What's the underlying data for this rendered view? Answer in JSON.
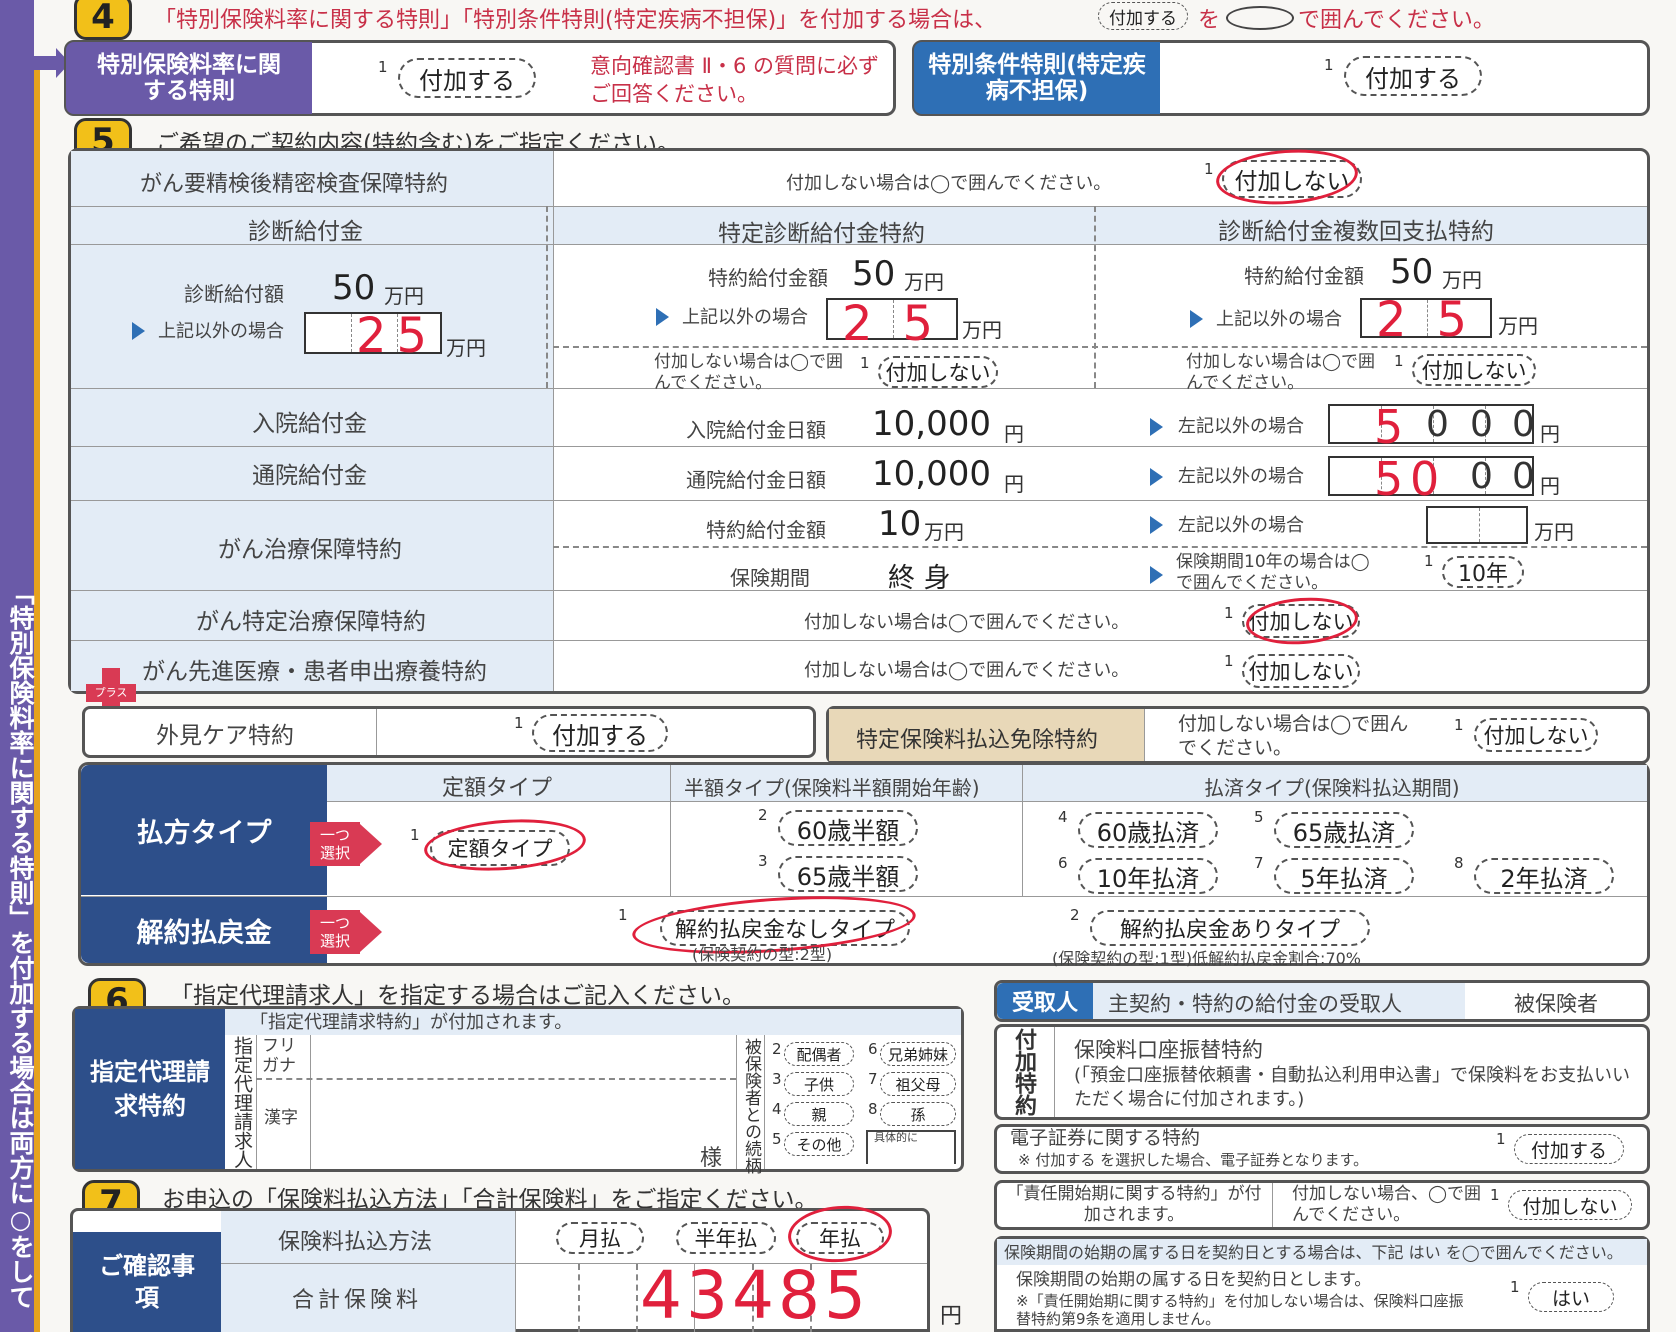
{
  "sidebar": {
    "text": "「特別保険料率に関する特則」を付加する場合は両方に○をして"
  },
  "s4": {
    "num": "4",
    "header_a": "「特別保険料率に関する特則」「特別条件特則(特定疾病不担保)」を付加する場合は、",
    "header_pill": "付加する",
    "header_b": "を",
    "header_c": "で囲んでください。",
    "left_title": "特別保険料率に関する特則",
    "left_no": "1",
    "left_opt": "付加する",
    "left_note": "意向確認書 Ⅱ・6 の質問に必ずご回答ください。",
    "right_title": "特別条件特則(特定疾病不担保)",
    "right_no": "1",
    "right_opt": "付加する"
  },
  "s5": {
    "num": "5",
    "title": "ご希望のご契約内容(特約含む)をご指定ください。",
    "gan_kensa": {
      "label": "がん要精検後精密検査保障特約",
      "note": "付加しない場合は◯で囲んでください。",
      "no": "1",
      "opt": "付加しない"
    },
    "shindan": {
      "label": "診断給付金",
      "amount_label": "診断給付額",
      "amount": "50",
      "amount_unit": "万円",
      "other_label": "上記以外の場合",
      "other_value": "25",
      "other_unit": "万円"
    },
    "tokutei_shindan": {
      "label": "特定診断給付金特約",
      "amount_label": "特約給付金額",
      "amount": "50",
      "amount_unit": "万円",
      "other_label": "上記以外の場合",
      "other_value": "25",
      "other_unit": "万円",
      "note": "付加しない場合は◯で囲んでください。",
      "no": "1",
      "opt": "付加しない"
    },
    "fukusu": {
      "label": "診断給付金複数回支払特約",
      "amount_label": "特約給付金額",
      "amount": "50",
      "amount_unit": "万円",
      "other_label": "上記以外の場合",
      "other_value": "25",
      "other_unit": "万円",
      "note": "付加しない場合は◯で囲んでください。",
      "no": "1",
      "opt": "付加しない"
    },
    "nyuin": {
      "label": "入院給付金",
      "amount_label": "入院給付金日額",
      "amount": "10,000",
      "unit": "円",
      "other_label": "左記以外の場合",
      "digits": [
        "5",
        "0",
        "0",
        "0"
      ],
      "other_unit": "円"
    },
    "tsuin": {
      "label": "通院給付金",
      "amount_label": "通院給付金日額",
      "amount": "10,000",
      "unit": "円",
      "other_label": "左記以外の場合",
      "digits": [
        "5",
        "0",
        "0",
        "0"
      ],
      "other_unit": "円"
    },
    "gan_chiryo": {
      "label": "がん治療保障特約",
      "amount_label": "特約給付金額",
      "amount": "10",
      "amount_unit": "万円",
      "other_label": "左記以外の場合",
      "other_unit": "万円",
      "period_label": "保険期間",
      "period": "終 身",
      "period10_note": "保険期間10年の場合は◯で囲んでください。",
      "no": "1",
      "opt": "10年"
    },
    "gan_tokutei": {
      "label": "がん特定治療保障特約",
      "note": "付加しない場合は◯で囲んでください。",
      "no": "1",
      "opt": "付加しない"
    },
    "gan_senshin": {
      "label": "がん先進医療・患者申出療養特約",
      "note": "付加しない場合は◯で囲んでください。",
      "no": "1",
      "opt": "付加しない"
    },
    "plus_tag": "プラス",
    "gaiken": {
      "label": "外見ケア特約",
      "no": "1",
      "opt": "付加する"
    },
    "menjo": {
      "label": "特定保険料払込免除特約",
      "note": "付加しない場合は◯で囲んでください。",
      "no": "1",
      "opt": "付加しない"
    },
    "harai": {
      "label": "払方タイプ",
      "select_tag": "一つ選択",
      "col1": "定額タイプ",
      "col2": "半額タイプ(保険料半額開始年齢)",
      "col3": "払済タイプ(保険料払込期間)",
      "opts": [
        {
          "no": "1",
          "label": "定額タイプ"
        },
        {
          "no": "2",
          "label": "60歳半額"
        },
        {
          "no": "3",
          "label": "65歳半額"
        },
        {
          "no": "4",
          "label": "60歳払済"
        },
        {
          "no": "5",
          "label": "65歳払済"
        },
        {
          "no": "6",
          "label": "10年払済"
        },
        {
          "no": "7",
          "label": "5年払済"
        },
        {
          "no": "8",
          "label": "2年払済"
        }
      ]
    },
    "kaiyaku": {
      "label": "解約払戻金",
      "select_tag": "一つ選択",
      "opt1_no": "1",
      "opt1": "解約払戻金なしタイプ",
      "opt1_note": "(保険契約の型:2型)",
      "opt2_no": "2",
      "opt2": "解約払戻金ありタイプ",
      "opt2_note": "(保険契約の型:1型)低解約払戻金割合:70%"
    }
  },
  "s6": {
    "num": "6",
    "title": "「指定代理請求人」を指定する場合はご記入ください。",
    "sub": "「指定代理請求特約」が付加されます。",
    "side": "指定代理請求特約",
    "vlabel": "指定代理請求人",
    "furigana": "フリガナ",
    "kanji": "漢字",
    "sama": "様",
    "rel_label": "被保険者との続柄",
    "rels": [
      {
        "no": "2",
        "label": "配偶者"
      },
      {
        "no": "6",
        "label": "兄弟姉妹"
      },
      {
        "no": "3",
        "label": "子供"
      },
      {
        "no": "7",
        "label": "祖父母"
      },
      {
        "no": "4",
        "label": "親"
      },
      {
        "no": "8",
        "label": "孫"
      },
      {
        "no": "5",
        "label": "その他"
      }
    ],
    "gutai": "具体的に"
  },
  "right": {
    "uketori_tag": "受取人",
    "uketori_label": "主契約・特約の給付金の受取人",
    "uketori_value": "被保険者",
    "fuka_side": "付加特約",
    "koza_title": "保険料口座振替特約",
    "koza_note": "(「預金口座振替依頼書・自動払込利用申込書」で保険料をお支払いいただく場合に付加されます。)",
    "denshi_title": "電子証券に関する特約",
    "denshi_note": "※ 付加する を選択した場合、電子証券となります。",
    "denshi_no": "1",
    "denshi_opt": "付加する",
    "sekinin_title": "「責任開始期に関する特約」が付加されます。",
    "sekinin_note": "付加しない場合、◯で囲んでください。",
    "sekinin_no": "1",
    "sekinin_opt": "付加しない",
    "kishi_header": "保険期間の始期の属する日を契約日とする場合は、下記 はい を◯で囲んでください。",
    "kishi_text": "保険期間の始期の属する日を契約日とします。",
    "kishi_note": "※「責任開始期に関する特約」を付加しない場合は、保険料口座振替特約第9条を適用しません。",
    "kishi_no": "1",
    "kishi_opt": "はい"
  },
  "s7": {
    "num": "7",
    "title": "お申込の「保険料払込方法」「合計保険料」をご指定ください。",
    "side": "ご確認事項",
    "method_label": "保険料払込方法",
    "methods": [
      "月払",
      "半年払",
      "年払"
    ],
    "total_label": "合計保険料",
    "total": "43485",
    "total_unit": "円"
  }
}
